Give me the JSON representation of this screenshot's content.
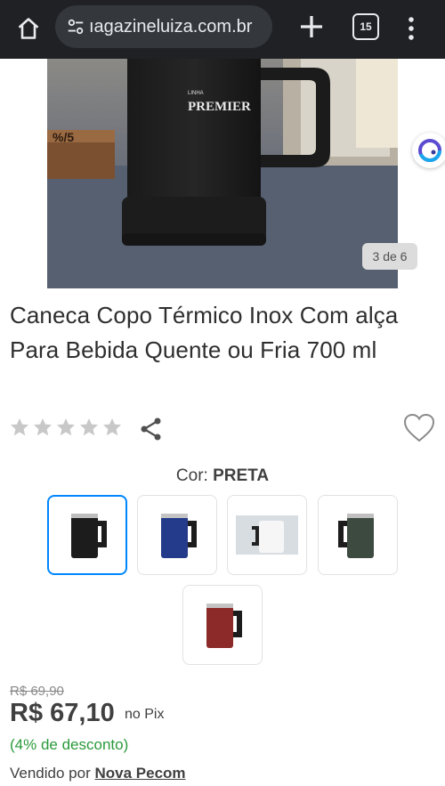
{
  "browser": {
    "url_display": "ıagazineluiza.com.br",
    "tab_count": "15"
  },
  "gallery": {
    "counter": "3 de 6",
    "current": 3,
    "total": 6,
    "image_brand_top": "LINHA",
    "image_brand": "PREMIER",
    "image_block_text": "%/5"
  },
  "product": {
    "title": "Caneca Copo Térmico Inox Com alça Para Bebida Quente ou Fria 700 ml",
    "rating_stars_filled": 0,
    "rating_stars_total": 5
  },
  "color": {
    "label": "Cor:",
    "selected": "PRETA",
    "options": [
      {
        "name": "preta",
        "hex": "#1c1c1c"
      },
      {
        "name": "azul",
        "hex": "#243a8a"
      },
      {
        "name": "branca",
        "hex": "#f2f2f2"
      },
      {
        "name": "verde",
        "hex": "#3c4a40"
      },
      {
        "name": "vermelha",
        "hex": "#8c2a2a"
      }
    ]
  },
  "pricing": {
    "old_price": "R$ 69,90",
    "price": "R$ 67,10",
    "price_suffix": "no Pix",
    "discount": "(4% de desconto)",
    "sold_by_label": "Vendido por",
    "seller": "Nova Pecom"
  },
  "colors": {
    "browser_bar": "#1f2124",
    "selected_border": "#0086ff",
    "discount_green": "#2a9a3a",
    "star_gray": "#c8c8c8"
  }
}
